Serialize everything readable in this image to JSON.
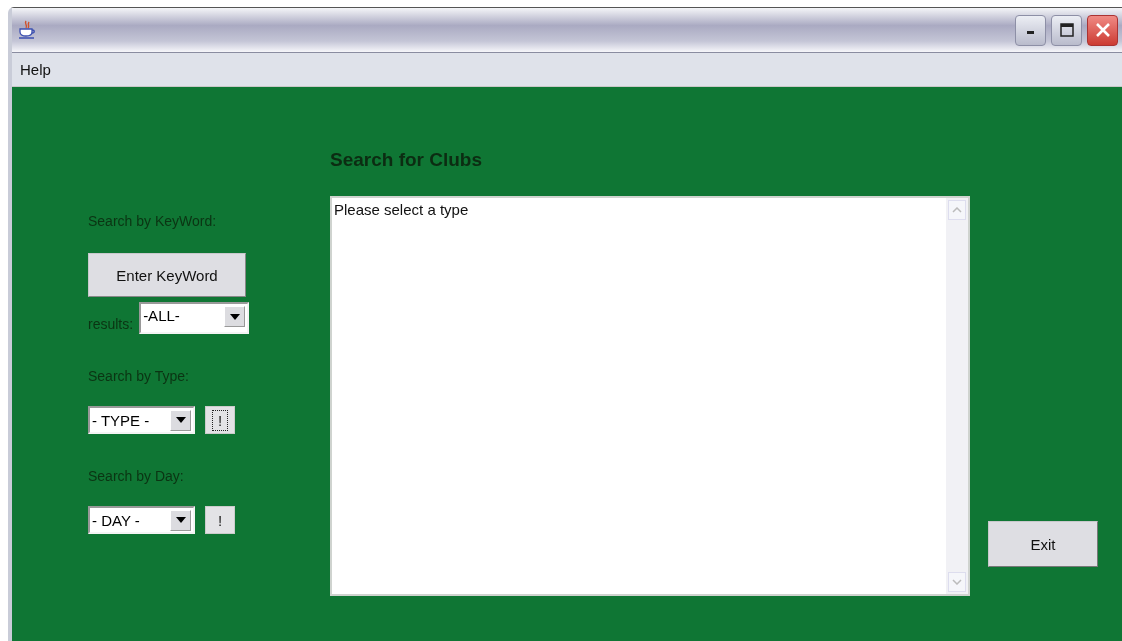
{
  "menu": [
    {
      "label": "Help"
    }
  ],
  "heading": "Search for Clubs",
  "keyword": {
    "label": "Search by KeyWord:",
    "button": "Enter KeyWord",
    "results_label": "results:",
    "results_value": "-ALL-"
  },
  "type": {
    "label": "Search by Type:",
    "value": "- TYPE -",
    "button": "!",
    "focused": true
  },
  "day": {
    "label": "Search by Day:",
    "value": "- DAY -",
    "button": "!",
    "focused": false
  },
  "output": {
    "text": "Please select a type"
  },
  "exit_button": "Exit"
}
